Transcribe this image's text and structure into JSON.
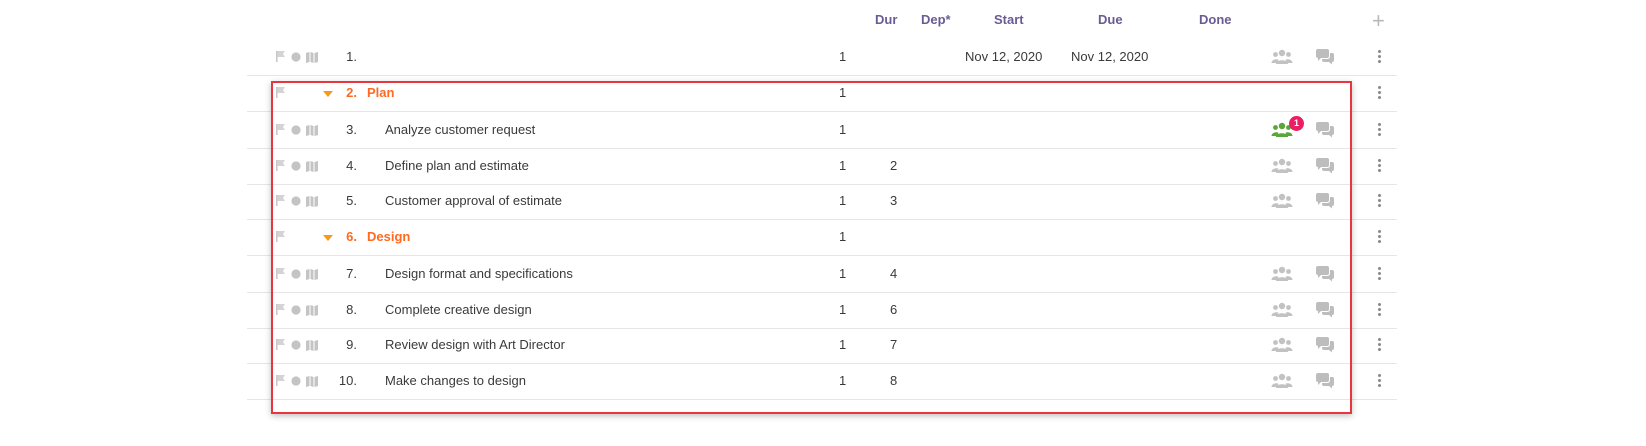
{
  "header": {
    "dur": "Dur",
    "dep": "Dep*",
    "start": "Start",
    "due": "Due",
    "done": "Done",
    "add_icon": "plus-icon"
  },
  "colors": {
    "accent_header": "#6b5b95",
    "phase": "#ff6a21",
    "caret": "#f29a1a",
    "selection_border": "#e8363e",
    "assigned_green": "#5aa63a",
    "badge": "#e91e63"
  },
  "rows": [
    {
      "num": "1.",
      "name": "",
      "dur": "1",
      "dep": "",
      "start": "Nov 12, 2020",
      "due": "Nov 12, 2020",
      "phase": false
    },
    {
      "num": "2.",
      "name": "Plan",
      "dur": "1",
      "dep": "",
      "start": "",
      "due": "",
      "phase": true
    },
    {
      "num": "3.",
      "name": "Analyze customer request",
      "dur": "1",
      "dep": "",
      "start": "",
      "due": "",
      "phase": false,
      "assigned": true,
      "badge": "1"
    },
    {
      "num": "4.",
      "name": "Define plan and estimate",
      "dur": "1",
      "dep": "2",
      "start": "",
      "due": "",
      "phase": false
    },
    {
      "num": "5.",
      "name": "Customer approval of estimate",
      "dur": "1",
      "dep": "3",
      "start": "",
      "due": "",
      "phase": false
    },
    {
      "num": "6.",
      "name": "Design",
      "dur": "1",
      "dep": "",
      "start": "",
      "due": "",
      "phase": true
    },
    {
      "num": "7.",
      "name": "Design format and specifications",
      "dur": "1",
      "dep": "4",
      "start": "",
      "due": "",
      "phase": false
    },
    {
      "num": "8.",
      "name": "Complete creative design",
      "dur": "1",
      "dep": "6",
      "start": "",
      "due": "",
      "phase": false
    },
    {
      "num": "9.",
      "name": "Review design with Art Director",
      "dur": "1",
      "dep": "7",
      "start": "",
      "due": "",
      "phase": false
    },
    {
      "num": "10.",
      "name": "Make changes to design",
      "dur": "1",
      "dep": "8",
      "start": "",
      "due": "",
      "phase": false
    }
  ]
}
